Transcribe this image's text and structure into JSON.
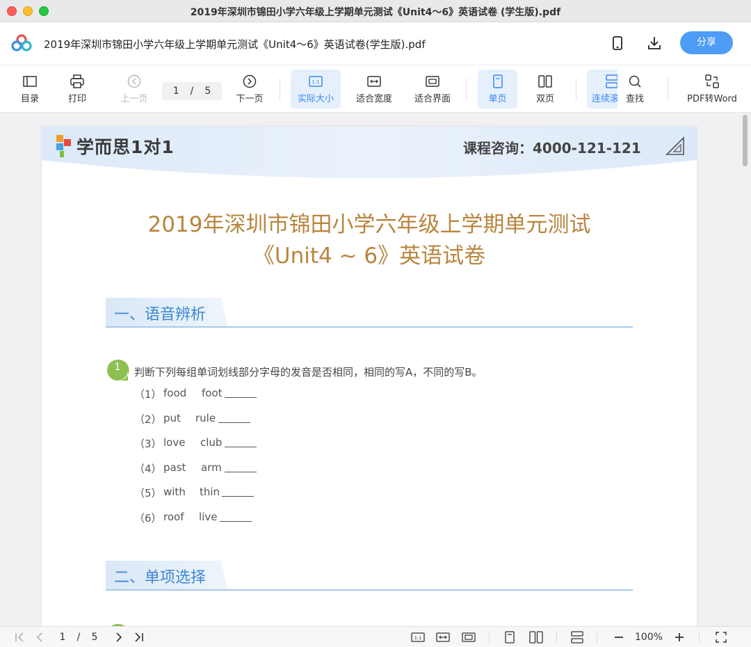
{
  "window": {
    "title": "2019年深圳市锦田小学六年级上学期单元测试《Unit4～6》英语试卷 (学生版).pdf"
  },
  "header": {
    "file_title": "2019年深圳市锦田小学六年级上学期单元测试《Unit4～6》英语试卷(学生版).pdf",
    "share_label": "分享",
    "icons": [
      "phone-icon",
      "download-icon"
    ]
  },
  "toolbar": {
    "toc": "目录",
    "print": "打印",
    "prev": "上一页",
    "page_current": "1",
    "page_sep": "/",
    "page_total": "5",
    "next": "下一页",
    "actual_size": "实际大小",
    "fit_width": "适合宽度",
    "fit_page": "适合界面",
    "single": "单页",
    "double": "双页",
    "continuous": "连续滚",
    "find": "查找",
    "to_word": "PDF转Word"
  },
  "document": {
    "brand": "学而思1对1",
    "hotline": "课程咨询：4000-121-121",
    "title_line1": "2019年深圳市锦田小学六年级上学期单元测试",
    "title_line2": "《Unit4 ~ 6》英语试卷",
    "section1_title": "一、语音辨析",
    "q1_number": "1",
    "q1_text": "判断下列每组单词划线部分字母的发音是否相同，相同的写A，不同的写B。",
    "items": [
      {
        "num": "（1）",
        "w1": "food",
        "w2": "foot"
      },
      {
        "num": "（2）",
        "w1": "put",
        "w2": "rule"
      },
      {
        "num": "（3）",
        "w1": "love",
        "w2": "club"
      },
      {
        "num": "（4）",
        "w1": "past",
        "w2": "arm"
      },
      {
        "num": "（5）",
        "w1": "with",
        "w2": "thin"
      },
      {
        "num": "（6）",
        "w1": "roof",
        "w2": "live"
      }
    ],
    "section2_title": "二、单项选择"
  },
  "bottombar": {
    "page_current": "1",
    "page_sep": "/",
    "page_total": "5",
    "zoom": "100%"
  },
  "colors": {
    "accent": "#4d9cf6",
    "title": "#b8853e",
    "section": "#3d87d0",
    "badge": "#8cc152"
  }
}
